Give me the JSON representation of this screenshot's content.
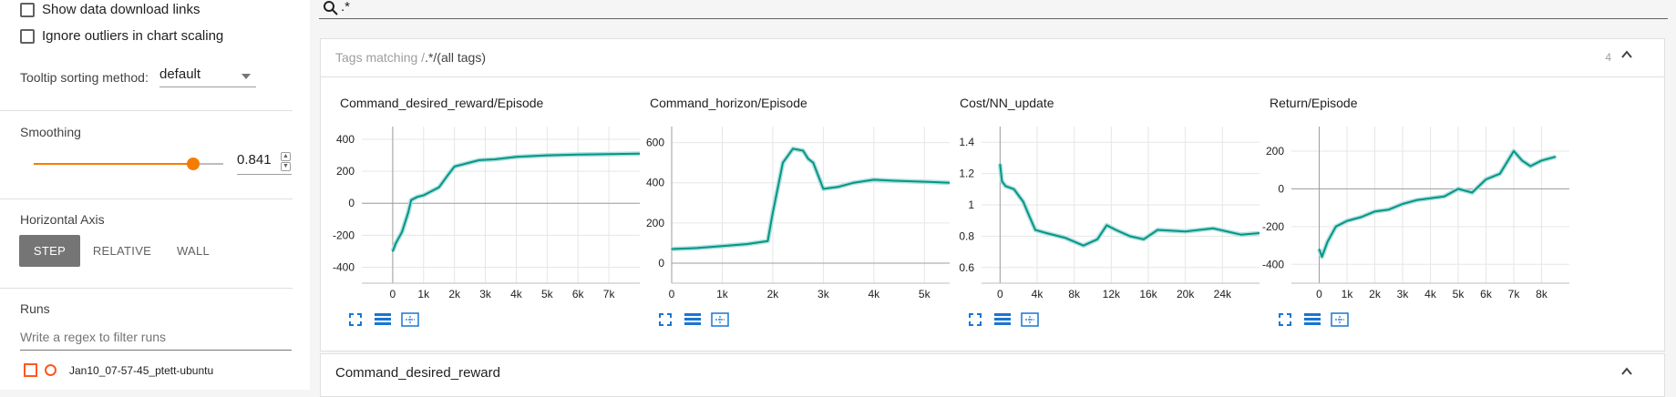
{
  "sidebar": {
    "show_download_links": "Show data download links",
    "ignore_outliers": "Ignore outliers in chart scaling",
    "tooltip_label": "Tooltip sorting method:",
    "tooltip_value": "default",
    "smoothing_label": "Smoothing",
    "smoothing_value": "0.841",
    "smoothing_fraction": 0.841,
    "horizontal_axis_label": "Horizontal Axis",
    "axis_options": [
      "STEP",
      "RELATIVE",
      "WALL"
    ],
    "axis_selected": "STEP",
    "runs_label": "Runs",
    "runs_filter_placeholder": "Write a regex to filter runs",
    "run_name": "Jan10_07-57-45_ptett-ubuntu"
  },
  "search": {
    "value": ".*"
  },
  "card": {
    "tags_prefix": "Tags matching /",
    "tags_pattern": ".*",
    "tags_suffix": "/(all tags)",
    "count": "4"
  },
  "card2": {
    "title": "Command_desired_reward"
  },
  "colors": {
    "accent": "#f57c00",
    "series": "#009688",
    "series_light": "#b2dfdb",
    "icon": "#1976d2"
  },
  "chart_data": [
    {
      "type": "line",
      "title": "Command_desired_reward/Episode",
      "xticks": [
        "0",
        "1k",
        "2k",
        "3k",
        "4k",
        "5k",
        "6k",
        "7k"
      ],
      "yticks": [
        "400",
        "200",
        "0",
        "-200",
        "-400"
      ],
      "xlim": [
        -1000,
        8000
      ],
      "ylim": [
        -500,
        480
      ],
      "series": [
        {
          "x": [
            0,
            100,
            300,
            500,
            600,
            800,
            1000,
            1300,
            1500,
            1800,
            2000,
            2400,
            2800,
            3300,
            4000,
            5000,
            6000,
            7000,
            8000
          ],
          "y": [
            -300,
            -250,
            -180,
            -60,
            20,
            40,
            50,
            80,
            100,
            180,
            230,
            250,
            270,
            275,
            290,
            300,
            305,
            308,
            310
          ]
        }
      ]
    },
    {
      "type": "line",
      "title": "Command_horizon/Episode",
      "xticks": [
        "0",
        "1k",
        "2k",
        "3k",
        "4k",
        "5k"
      ],
      "yticks": [
        "600",
        "400",
        "200",
        "0"
      ],
      "xlim": [
        0,
        5500
      ],
      "ylim": [
        -100,
        680
      ],
      "series": [
        {
          "x": [
            0,
            500,
            1000,
            1500,
            1900,
            2000,
            2200,
            2400,
            2600,
            2700,
            2800,
            3000,
            3300,
            3600,
            4000,
            4400,
            5000,
            5500
          ],
          "y": [
            70,
            75,
            85,
            95,
            110,
            250,
            500,
            570,
            560,
            520,
            500,
            370,
            380,
            400,
            415,
            410,
            405,
            400
          ]
        }
      ]
    },
    {
      "type": "line",
      "title": "Cost/NN_update",
      "xticks": [
        "0",
        "4k",
        "8k",
        "12k",
        "16k",
        "20k",
        "24k"
      ],
      "yticks": [
        "1.4",
        "1.2",
        "1",
        "0.8",
        "0.6"
      ],
      "xlim": [
        -2000,
        28000
      ],
      "ylim": [
        0.5,
        1.5
      ],
      "series": [
        {
          "x": [
            0,
            200,
            600,
            1500,
            2500,
            3000,
            3800,
            5000,
            7000,
            9000,
            10500,
            11500,
            12500,
            14000,
            15500,
            17000,
            20000,
            23000,
            26000,
            28000
          ],
          "y": [
            1.26,
            1.15,
            1.12,
            1.1,
            1.02,
            0.95,
            0.84,
            0.82,
            0.79,
            0.74,
            0.78,
            0.87,
            0.84,
            0.8,
            0.78,
            0.84,
            0.83,
            0.85,
            0.81,
            0.82
          ]
        }
      ]
    },
    {
      "type": "line",
      "title": "Return/Episode",
      "xticks": [
        "0",
        "1k",
        "2k",
        "3k",
        "4k",
        "5k",
        "6k",
        "7k",
        "8k"
      ],
      "yticks": [
        "200",
        "0",
        "-200",
        "-400"
      ],
      "xlim": [
        -1000,
        9000
      ],
      "ylim": [
        -500,
        330
      ],
      "series": [
        {
          "x": [
            0,
            100,
            300,
            600,
            1000,
            1500,
            2000,
            2500,
            3000,
            3500,
            4000,
            4500,
            5000,
            5500,
            6000,
            6500,
            7000,
            7300,
            7600,
            8000,
            8500
          ],
          "y": [
            -320,
            -360,
            -280,
            -200,
            -170,
            -150,
            -120,
            -110,
            -80,
            -60,
            -50,
            -40,
            0,
            -20,
            50,
            80,
            200,
            150,
            120,
            150,
            170
          ]
        }
      ]
    }
  ]
}
